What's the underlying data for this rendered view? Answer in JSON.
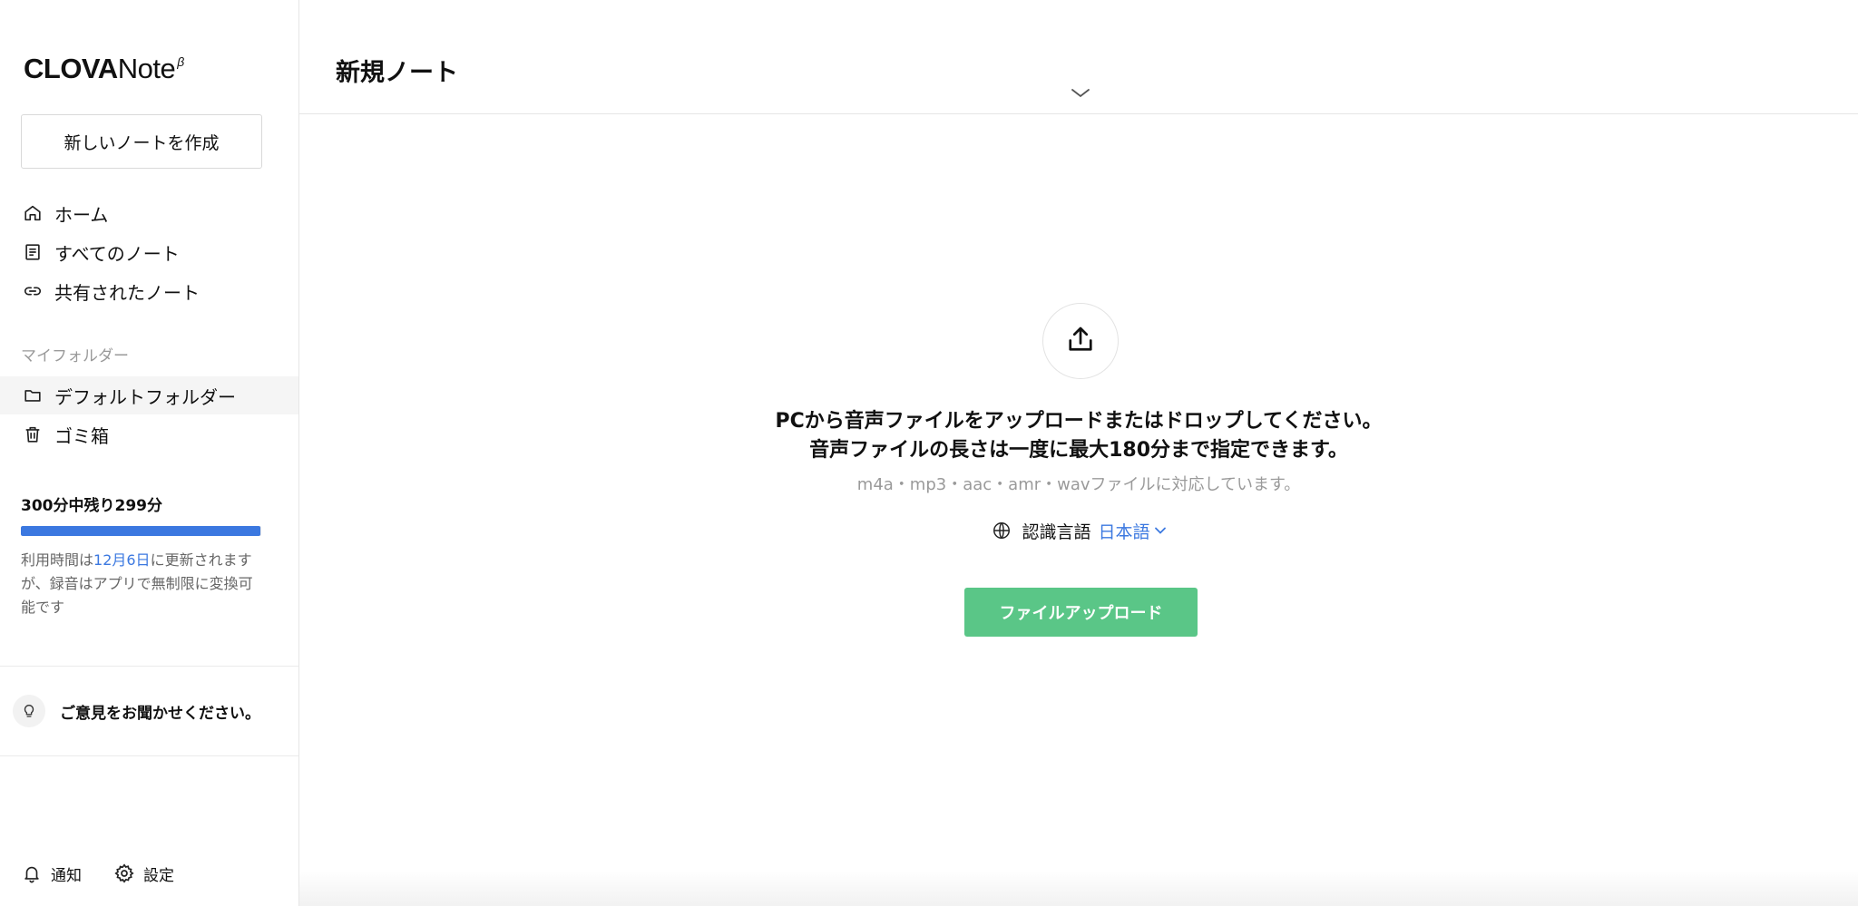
{
  "app": {
    "logo_main": "CLOVA",
    "logo_sub": "Note",
    "logo_badge": "β"
  },
  "sidebar": {
    "new_note_label": "新しいノートを作成",
    "nav": [
      {
        "label": "ホーム",
        "icon": "home-icon"
      },
      {
        "label": "すべてのノート",
        "icon": "document-icon"
      },
      {
        "label": "共有されたノート",
        "icon": "link-icon"
      }
    ],
    "folder_section_label": "マイフォルダー",
    "folders": [
      {
        "label": "デフォルトフォルダー",
        "icon": "folder-icon",
        "active": true
      },
      {
        "label": "ゴミ箱",
        "icon": "trash-icon",
        "active": false
      }
    ],
    "usage": {
      "title": "300分中残り299分",
      "used_fraction": 0.9967,
      "note_prefix": "利用時間は",
      "note_date": "12月6日",
      "note_suffix": "に更新されますが、録音はアプリで無制限に変換可能です"
    },
    "feedback_label": "ご意見をお聞かせください。",
    "bottom": {
      "notifications_label": "通知",
      "settings_label": "設定"
    }
  },
  "main": {
    "title": "新規ノート",
    "upload": {
      "line1": "PCから音声ファイルをアップロードまたはドロップしてください。",
      "line2": "音声ファイルの長さは一度に最大180分まで指定できます。",
      "formats": "m4a・mp3・aac・amr・wavファイルに対応しています。",
      "language_label": "認識言語",
      "language_value": "日本語",
      "button_label": "ファイルアップロード"
    }
  },
  "colors": {
    "accent_blue": "#3b78e0",
    "upload_green": "#5ac687"
  }
}
